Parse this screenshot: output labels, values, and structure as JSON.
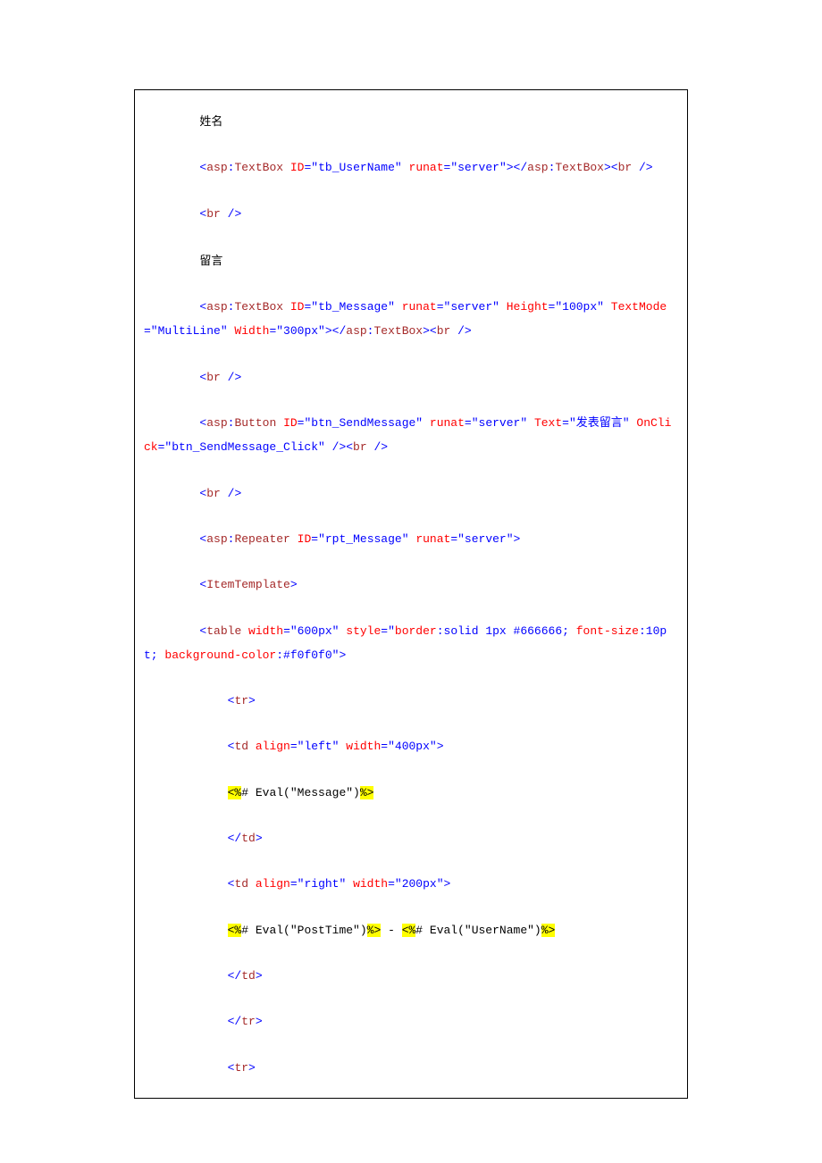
{
  "lines": [
    {
      "indent": 2,
      "parts": [
        {
          "cls": "cjk",
          "text": "姓名"
        }
      ]
    },
    {
      "indent": 2,
      "parts": [
        {
          "cls": "blue",
          "text": "<"
        },
        {
          "cls": "maroon",
          "text": "asp"
        },
        {
          "cls": "blue",
          "text": ":"
        },
        {
          "cls": "maroon",
          "text": "TextBox "
        },
        {
          "cls": "red",
          "text": "ID"
        },
        {
          "cls": "blue",
          "text": "=\"tb_UserName\" "
        },
        {
          "cls": "red",
          "text": "runat"
        },
        {
          "cls": "blue",
          "text": "=\"server\"></"
        },
        {
          "cls": "maroon",
          "text": "asp"
        },
        {
          "cls": "blue",
          "text": ":"
        },
        {
          "cls": "maroon",
          "text": "TextBox"
        },
        {
          "cls": "blue",
          "text": "><"
        },
        {
          "cls": "maroon",
          "text": "br "
        },
        {
          "cls": "blue",
          "text": "/>"
        }
      ]
    },
    {
      "indent": 2,
      "parts": [
        {
          "cls": "blue",
          "text": "<"
        },
        {
          "cls": "maroon",
          "text": "br "
        },
        {
          "cls": "blue",
          "text": "/>"
        }
      ]
    },
    {
      "indent": 2,
      "parts": [
        {
          "cls": "cjk",
          "text": "留言"
        }
      ]
    },
    {
      "indent": 2,
      "parts": [
        {
          "cls": "blue",
          "text": "<"
        },
        {
          "cls": "maroon",
          "text": "asp"
        },
        {
          "cls": "blue",
          "text": ":"
        },
        {
          "cls": "maroon",
          "text": "TextBox "
        },
        {
          "cls": "red",
          "text": "ID"
        },
        {
          "cls": "blue",
          "text": "=\"tb_Message\" "
        },
        {
          "cls": "red",
          "text": "runat"
        },
        {
          "cls": "blue",
          "text": "=\"server\" "
        },
        {
          "cls": "red",
          "text": "Height"
        },
        {
          "cls": "blue",
          "text": "=\"100px\" "
        },
        {
          "cls": "red",
          "text": "TextMode"
        },
        {
          "cls": "blue",
          "text": "=\"MultiLine\" "
        },
        {
          "cls": "red",
          "text": "Width"
        },
        {
          "cls": "blue",
          "text": "=\"300px\"></"
        },
        {
          "cls": "maroon",
          "text": "asp"
        },
        {
          "cls": "blue",
          "text": ":"
        },
        {
          "cls": "maroon",
          "text": "TextBox"
        },
        {
          "cls": "blue",
          "text": "><"
        },
        {
          "cls": "maroon",
          "text": "br "
        },
        {
          "cls": "blue",
          "text": "/>"
        }
      ]
    },
    {
      "indent": 2,
      "parts": [
        {
          "cls": "blue",
          "text": "<"
        },
        {
          "cls": "maroon",
          "text": "br "
        },
        {
          "cls": "blue",
          "text": "/>"
        }
      ]
    },
    {
      "indent": 2,
      "parts": [
        {
          "cls": "blue",
          "text": "<"
        },
        {
          "cls": "maroon",
          "text": "asp"
        },
        {
          "cls": "blue",
          "text": ":"
        },
        {
          "cls": "maroon",
          "text": "Button "
        },
        {
          "cls": "red",
          "text": "ID"
        },
        {
          "cls": "blue",
          "text": "=\"btn_SendMessage\" "
        },
        {
          "cls": "red",
          "text": "runat"
        },
        {
          "cls": "blue",
          "text": "=\"server\" "
        },
        {
          "cls": "red",
          "text": "Text"
        },
        {
          "cls": "blue",
          "text": "=\""
        },
        {
          "cls": "blue",
          "text": "发表留言"
        },
        {
          "cls": "blue",
          "text": "\" "
        },
        {
          "cls": "red",
          "text": "OnClick"
        },
        {
          "cls": "blue",
          "text": "=\"btn_SendMessage_Click\" /><"
        },
        {
          "cls": "maroon",
          "text": "br "
        },
        {
          "cls": "blue",
          "text": "/>"
        }
      ]
    },
    {
      "indent": 2,
      "parts": [
        {
          "cls": "blue",
          "text": "<"
        },
        {
          "cls": "maroon",
          "text": "br "
        },
        {
          "cls": "blue",
          "text": "/>"
        }
      ]
    },
    {
      "indent": 2,
      "parts": [
        {
          "cls": "blue",
          "text": "<"
        },
        {
          "cls": "maroon",
          "text": "asp"
        },
        {
          "cls": "blue",
          "text": ":"
        },
        {
          "cls": "maroon",
          "text": "Repeater "
        },
        {
          "cls": "red",
          "text": "ID"
        },
        {
          "cls": "blue",
          "text": "=\"rpt_Message\" "
        },
        {
          "cls": "red",
          "text": "runat"
        },
        {
          "cls": "blue",
          "text": "=\"server\">"
        }
      ]
    },
    {
      "indent": 2,
      "parts": [
        {
          "cls": "blue",
          "text": "<"
        },
        {
          "cls": "maroon",
          "text": "ItemTemplate"
        },
        {
          "cls": "blue",
          "text": ">"
        }
      ]
    },
    {
      "indent": 2,
      "parts": [
        {
          "cls": "blue",
          "text": "<"
        },
        {
          "cls": "maroon",
          "text": "table "
        },
        {
          "cls": "red",
          "text": "width"
        },
        {
          "cls": "blue",
          "text": "=\"600px\" "
        },
        {
          "cls": "red",
          "text": "style"
        },
        {
          "cls": "blue",
          "text": "=\""
        },
        {
          "cls": "red",
          "text": "border"
        },
        {
          "cls": "blue",
          "text": ":solid 1px #666666; "
        },
        {
          "cls": "red",
          "text": "font-size"
        },
        {
          "cls": "blue",
          "text": ":10pt; "
        },
        {
          "cls": "red",
          "text": "background-color"
        },
        {
          "cls": "blue",
          "text": ":#f0f0f0\">"
        }
      ]
    },
    {
      "indent": 3,
      "parts": [
        {
          "cls": "blue",
          "text": "<"
        },
        {
          "cls": "maroon",
          "text": "tr"
        },
        {
          "cls": "blue",
          "text": ">"
        }
      ]
    },
    {
      "indent": 3,
      "parts": [
        {
          "cls": "blue",
          "text": "<"
        },
        {
          "cls": "maroon",
          "text": "td "
        },
        {
          "cls": "red",
          "text": "align"
        },
        {
          "cls": "blue",
          "text": "=\"left\" "
        },
        {
          "cls": "red",
          "text": "width"
        },
        {
          "cls": "blue",
          "text": "=\"400px\">"
        }
      ]
    },
    {
      "indent": 3,
      "parts": [
        {
          "cls": "hl",
          "text": "<%"
        },
        {
          "cls": "black",
          "text": "# Eval(\"Message\")"
        },
        {
          "cls": "hl",
          "text": "%>"
        }
      ]
    },
    {
      "indent": 3,
      "parts": [
        {
          "cls": "blue",
          "text": "</"
        },
        {
          "cls": "maroon",
          "text": "td"
        },
        {
          "cls": "blue",
          "text": ">"
        }
      ]
    },
    {
      "indent": 3,
      "parts": [
        {
          "cls": "blue",
          "text": "<"
        },
        {
          "cls": "maroon",
          "text": "td "
        },
        {
          "cls": "red",
          "text": "align"
        },
        {
          "cls": "blue",
          "text": "=\"right\" "
        },
        {
          "cls": "red",
          "text": "width"
        },
        {
          "cls": "blue",
          "text": "=\"200px\">"
        }
      ]
    },
    {
      "indent": 3,
      "parts": [
        {
          "cls": "hl",
          "text": "<%"
        },
        {
          "cls": "black",
          "text": "# Eval(\"PostTime\")"
        },
        {
          "cls": "hl",
          "text": "%>"
        },
        {
          "cls": "black",
          "text": " - "
        },
        {
          "cls": "hl",
          "text": "<%"
        },
        {
          "cls": "black",
          "text": "# Eval(\"UserName\")"
        },
        {
          "cls": "hl",
          "text": "%>"
        }
      ]
    },
    {
      "indent": 3,
      "parts": [
        {
          "cls": "blue",
          "text": "</"
        },
        {
          "cls": "maroon",
          "text": "td"
        },
        {
          "cls": "blue",
          "text": ">"
        }
      ]
    },
    {
      "indent": 3,
      "parts": [
        {
          "cls": "blue",
          "text": "</"
        },
        {
          "cls": "maroon",
          "text": "tr"
        },
        {
          "cls": "blue",
          "text": ">"
        }
      ]
    },
    {
      "indent": 3,
      "parts": [
        {
          "cls": "blue",
          "text": "<"
        },
        {
          "cls": "maroon",
          "text": "tr"
        },
        {
          "cls": "blue",
          "text": ">"
        }
      ]
    }
  ]
}
